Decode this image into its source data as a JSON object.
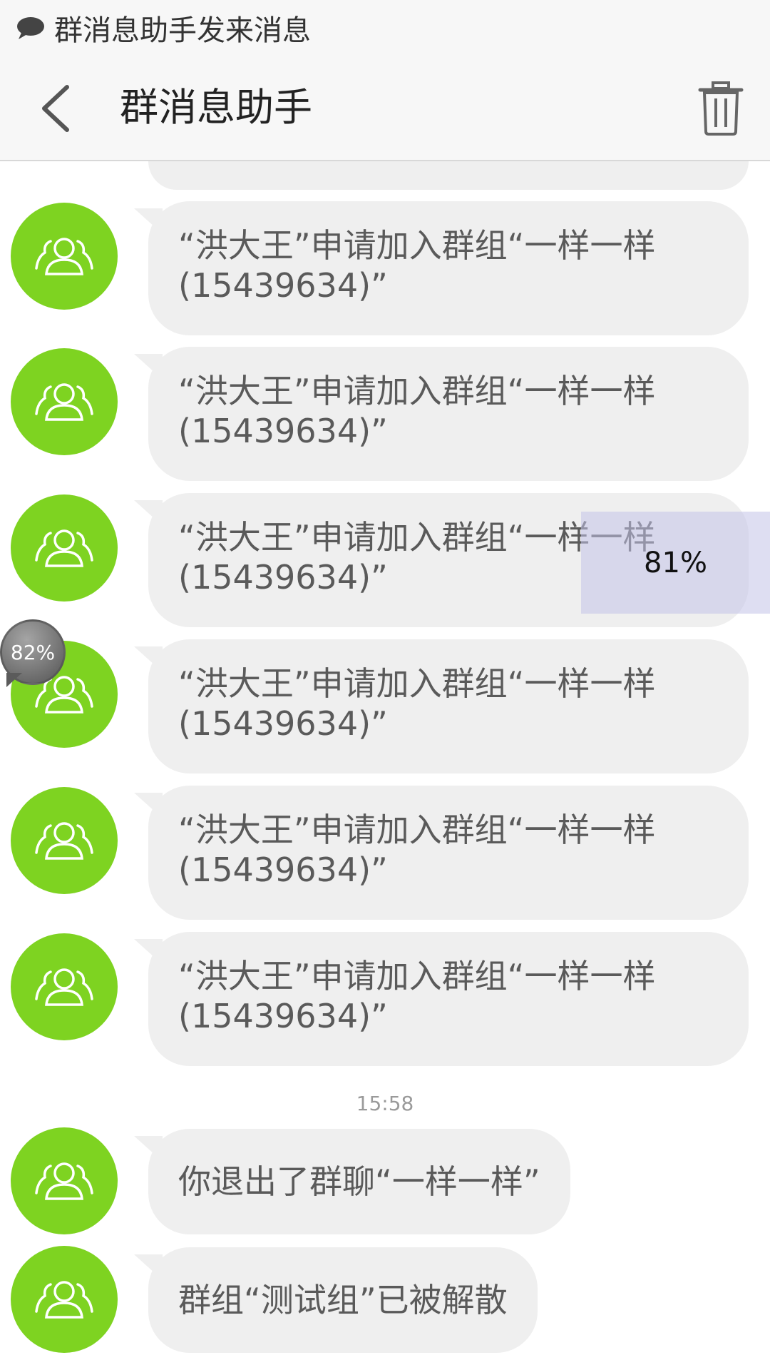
{
  "status_bar": {
    "notification": "群消息助手发来消息"
  },
  "header": {
    "title": "群消息助手"
  },
  "messages": [
    {
      "text": "“洪大王”申请加入群组“一样一样(15439634)”"
    },
    {
      "text": "“洪大王”申请加入群组“一样一样(15439634)”"
    },
    {
      "text": "“洪大王”申请加入群组“一样一样(15439634)”"
    },
    {
      "text": "“洪大王”申请加入群组“一样一样(15439634)”"
    },
    {
      "text": "“洪大王”申请加入群组“一样一样(15439634)”"
    },
    {
      "text": "“洪大王”申请加入群组“一样一样(15439634)”"
    }
  ],
  "timestamp": "15:58",
  "later_messages": [
    {
      "text": "你退出了群聊“一样一样”"
    },
    {
      "text": "群组“测试组”已被解散"
    }
  ],
  "overlays": {
    "percent_box": "81%",
    "percent_bubble": "82%"
  },
  "colors": {
    "avatar": "#7ed321",
    "bubble": "#efefef",
    "header": "#f7f7f7"
  },
  "icons": {
    "status": "chat-bubble-icon",
    "back": "back-arrow-icon",
    "delete": "trash-icon",
    "avatar": "group-people-icon"
  }
}
